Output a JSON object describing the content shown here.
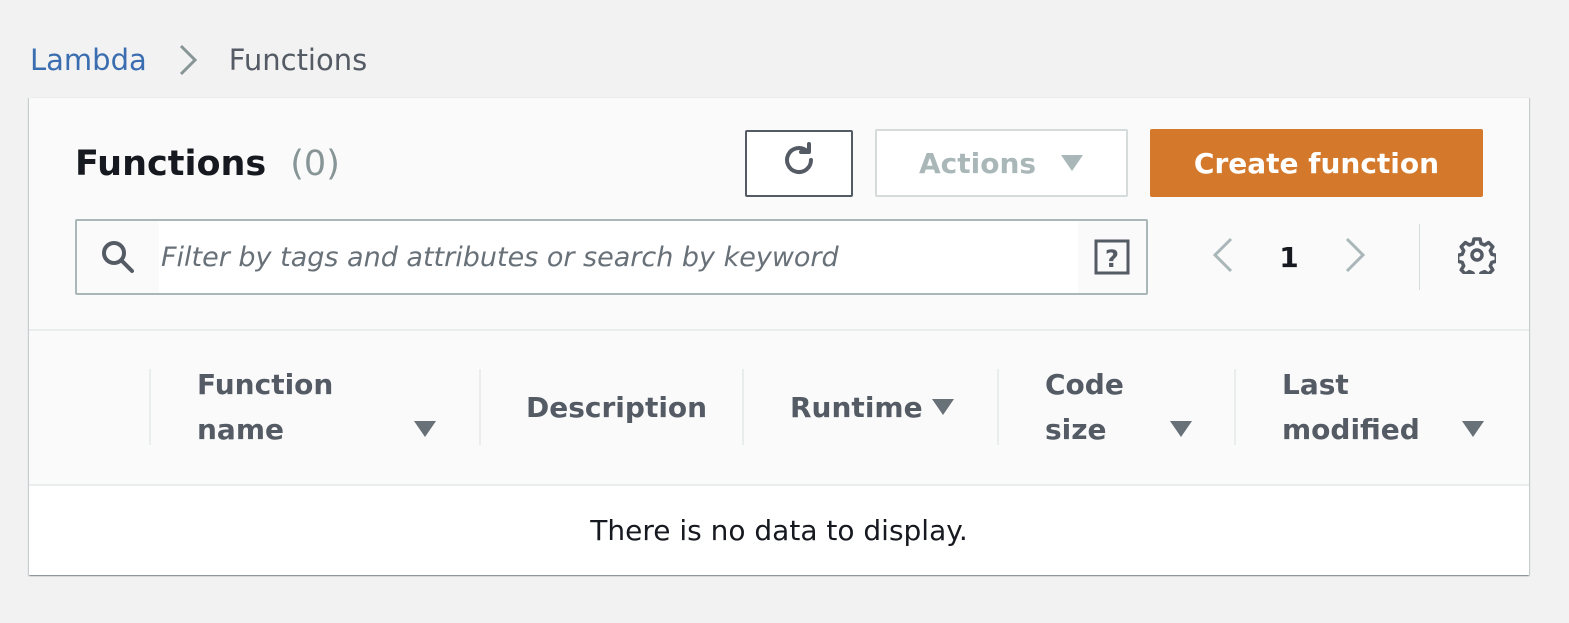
{
  "breadcrumb": {
    "parent": "Lambda",
    "current": "Functions"
  },
  "panel": {
    "title": "Functions",
    "count": "(0)"
  },
  "toolbar": {
    "refresh_icon": "refresh-icon",
    "actions_label": "Actions",
    "create_label": "Create function"
  },
  "search": {
    "placeholder": "Filter by tags and attributes or search by keyword",
    "value": ""
  },
  "pagination": {
    "current_page": "1"
  },
  "table": {
    "columns": [
      {
        "line1": "Function",
        "line2": "name"
      },
      {
        "line1": "Description",
        "line2": ""
      },
      {
        "line1": "Runtime",
        "line2": ""
      },
      {
        "line1": "Code",
        "line2": "size"
      },
      {
        "line1": "Last",
        "line2": "modified"
      }
    ],
    "empty_message": "There is no data to display."
  },
  "colors": {
    "accent": "#d4782b",
    "link": "#3b6eb0",
    "background": "#f2f2f2"
  }
}
